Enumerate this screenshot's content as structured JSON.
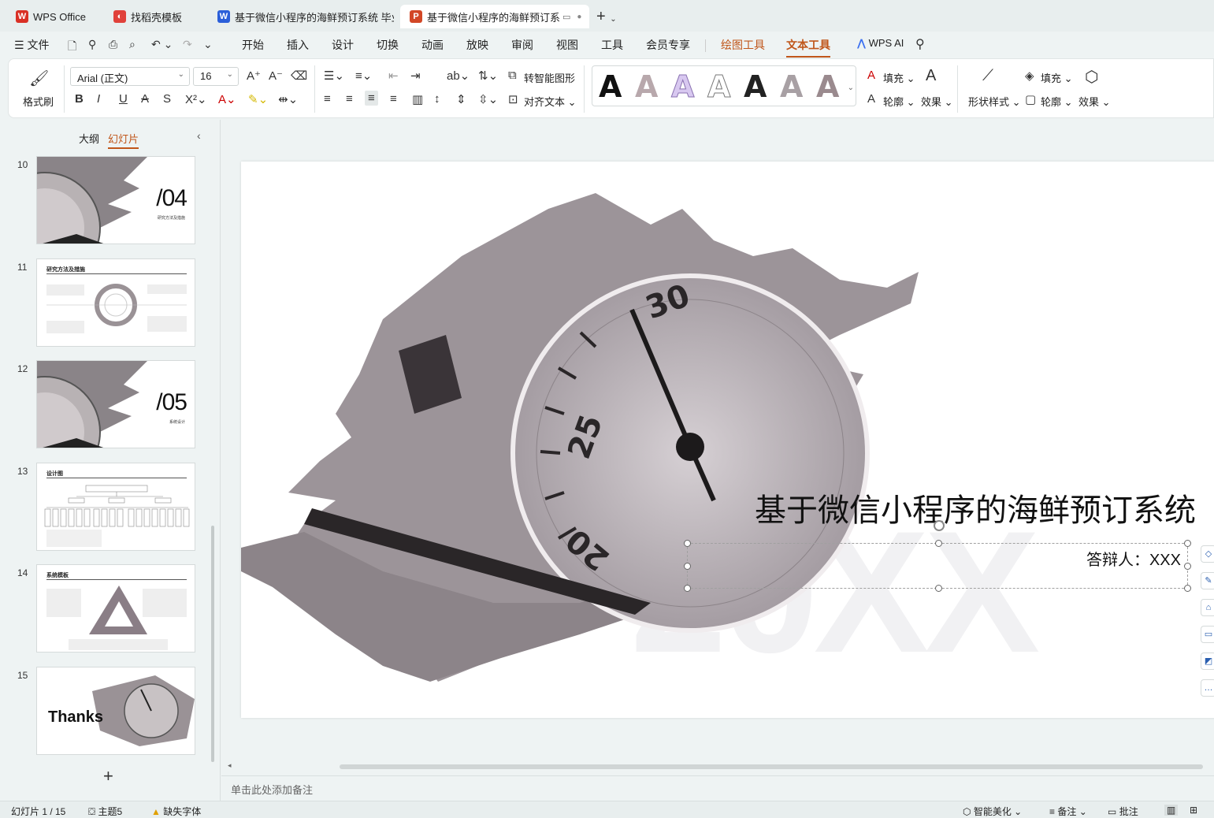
{
  "tabs": [
    {
      "label": "WPS Office",
      "icon": "wps-logo-icon",
      "color": "#d93025"
    },
    {
      "label": "找稻壳模板",
      "icon": "docer-icon",
      "color": "#e0413a"
    },
    {
      "label": "基于微信小程序的海鲜预订系统 毕业",
      "icon": "word-doc-icon",
      "color": "#2b5fd9"
    },
    {
      "label": "基于微信小程序的海鲜预订系统",
      "icon": "presentation-icon",
      "color": "#d24726"
    }
  ],
  "menu": {
    "file": "文件",
    "items": [
      "开始",
      "插入",
      "设计",
      "切换",
      "动画",
      "放映",
      "审阅",
      "视图",
      "工具",
      "会员专享"
    ],
    "context_tools": [
      "绘图工具",
      "文本工具"
    ],
    "ai": "WPS AI"
  },
  "ribbon": {
    "format_painter": "格式刷",
    "font_name": "Arial (正文)",
    "font_size": "16",
    "smart_shape": "转智能图形",
    "align_text": "对齐文本",
    "fill": "填充",
    "outline": "轮廓",
    "effect": "效果",
    "shape_style": "形状样式",
    "shape_fill": "填充",
    "shape_outline": "轮廓",
    "shape_effect": "效果",
    "style_glyph": "A"
  },
  "left_panel": {
    "tab_outline": "大纲",
    "tab_slides": "幻灯片",
    "slides": [
      {
        "num": "10",
        "big": "/04",
        "sub": "研究方法及措施",
        "kind": "section"
      },
      {
        "num": "11",
        "title": "研究方法及措施",
        "kind": "content"
      },
      {
        "num": "12",
        "big": "/05",
        "sub": "系统设计",
        "kind": "section"
      },
      {
        "num": "13",
        "title": "设计图",
        "kind": "content"
      },
      {
        "num": "14",
        "title": "系统模板",
        "kind": "content"
      },
      {
        "num": "15",
        "big": "Thanks",
        "kind": "thanks"
      }
    ],
    "add": "+"
  },
  "slide": {
    "title": "基于微信小程序的海鲜预订系统",
    "subtitle": "答辩人：XXX",
    "watermark": "20XX"
  },
  "notes_placeholder": "单击此处添加备注",
  "status": {
    "slide_counter": "幻灯片 1 / 15",
    "theme": "主题5",
    "missing_fonts": "缺失字体",
    "smart_beautify": "智能美化",
    "notes": "备注",
    "comments": "批注"
  },
  "colors": {
    "accent": "#c0561a",
    "canvas_bg": "#eef3f3"
  }
}
